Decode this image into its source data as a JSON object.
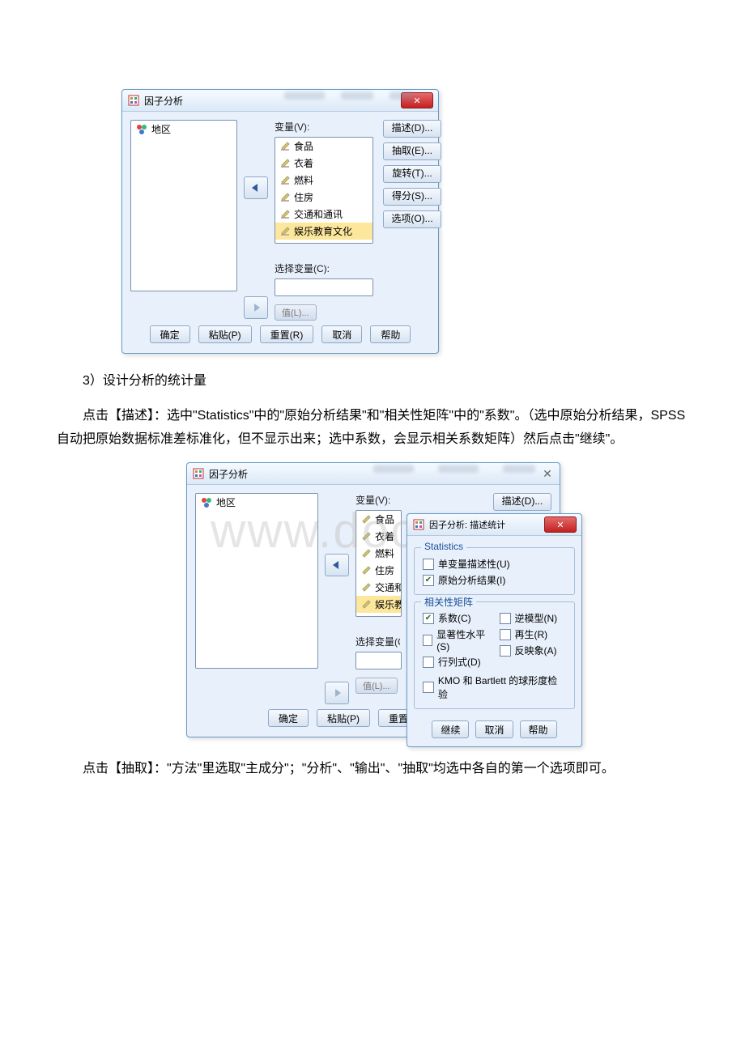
{
  "dialog1": {
    "title": "因子分析",
    "left_list_label": "",
    "left_items": [
      "地区"
    ],
    "var_label": "变量(V):",
    "var_items": [
      "食品",
      "衣着",
      "燃料",
      "住房",
      "交通和通讯",
      "娱乐教育文化"
    ],
    "selvar_label": "选择变量(C):",
    "value_btn": "值(L)...",
    "side_buttons": {
      "describe": "描述(D)...",
      "extract": "抽取(E)...",
      "rotate": "旋转(T)...",
      "scores": "得分(S)...",
      "options": "选项(O)..."
    },
    "bottom": {
      "ok": "确定",
      "paste": "粘贴(P)",
      "reset": "重置(R)",
      "cancel": "取消",
      "help": "帮助"
    }
  },
  "para1": "3）设计分析的统计量",
  "para2": "点击【描述】：选中\"Statistics\"中的\"原始分析结果\"和\"相关性矩阵\"中的\"系数\"。（选中原始分析结果，SPSS 自动把原始数据标准差标准化，但不显示出来；选中系数，会显示相关系数矩阵）然后点击\"继续\"。",
  "dialog2_sub": {
    "title": "因子分析: 描述统计",
    "group_stats": "Statistics",
    "chk_univariate": "单变量描述性(U)",
    "chk_initial": "原始分析结果(I)",
    "group_corr": "相关性矩阵",
    "chk_coeff": "系数(C)",
    "chk_inverse": "逆模型(N)",
    "chk_sig": "显著性水平(S)",
    "chk_repro": "再生(R)",
    "chk_det": "行列式(D)",
    "chk_anti": "反映象(A)",
    "chk_kmo": "KMO 和 Bartlett 的球形度检验",
    "btn_continue": "继续",
    "btn_cancel": "取消",
    "btn_help": "帮助"
  },
  "para3": "点击【抽取】：\"方法\"里选取\"主成分\"；\"分析\"、\"输出\"、\"抽取\"均选中各自的第一个选项即可。",
  "watermark": "www.docx.com"
}
